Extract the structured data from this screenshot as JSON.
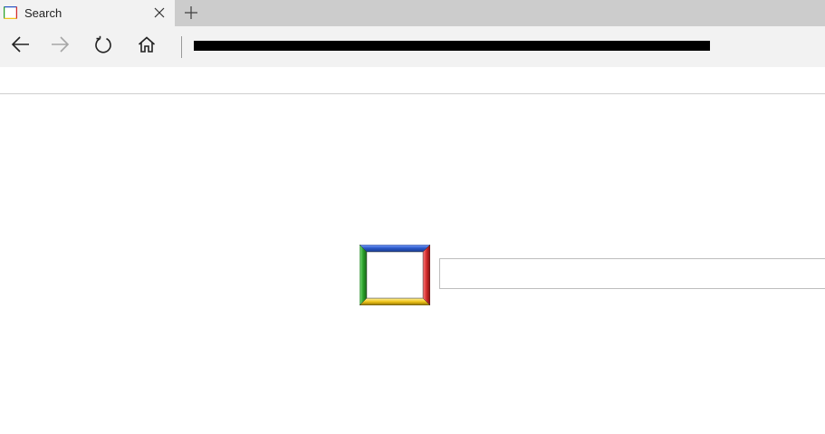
{
  "tab": {
    "title": "Search",
    "favicon": "tab-favicon-icon",
    "close_icon": "close-icon",
    "new_tab_icon": "plus-icon"
  },
  "nav": {
    "back_icon": "arrow-left-icon",
    "forward_icon": "arrow-right-icon",
    "refresh_icon": "refresh-icon",
    "home_icon": "home-icon"
  },
  "address_bar": {
    "value": "",
    "redacted": true
  },
  "search": {
    "value": "",
    "placeholder": ""
  },
  "logo": {
    "colors": [
      "#2a56c6",
      "#2aa02a",
      "#f0c419",
      "#d22b2b"
    ]
  },
  "colors": {
    "tabstrip_bg": "#cccccc",
    "active_tab_bg": "#f2f2f2",
    "page_bg": "#ffffff"
  }
}
